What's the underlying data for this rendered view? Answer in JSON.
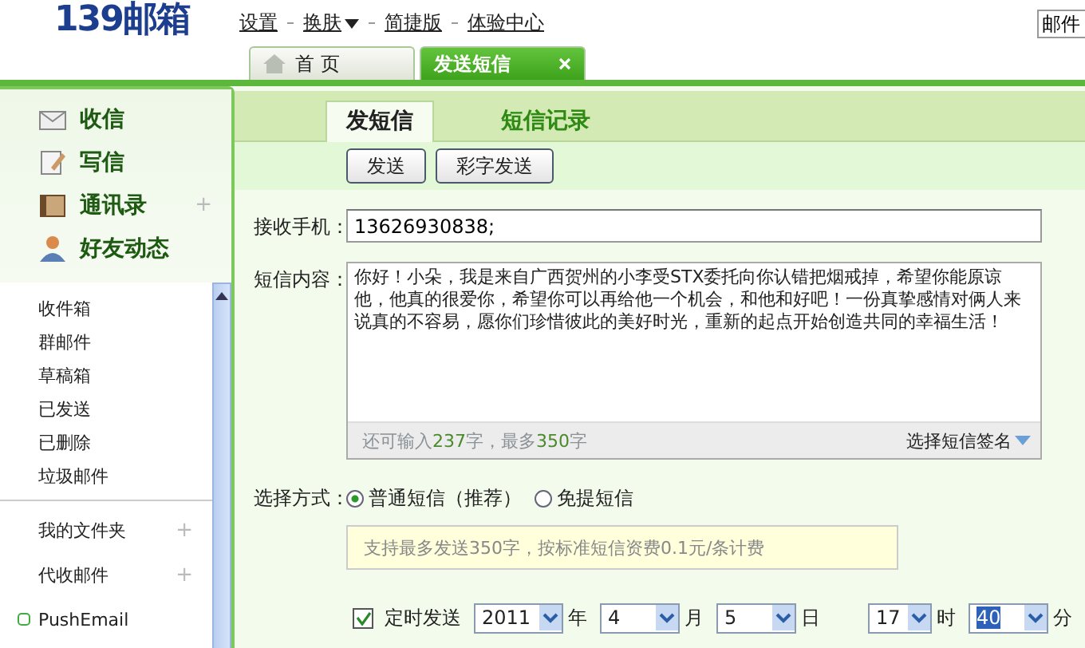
{
  "header": {
    "logo": "139邮箱",
    "links": [
      {
        "label": "设置",
        "dropdown": false
      },
      {
        "label": "换肤",
        "dropdown": true
      },
      {
        "label": "简捷版",
        "dropdown": false
      },
      {
        "label": "体验中心",
        "dropdown": false
      }
    ],
    "search_value": "邮件"
  },
  "tabs": [
    {
      "label": "首 页",
      "kind": "home",
      "selected": false
    },
    {
      "label": "发送短信",
      "kind": "closable",
      "selected": true
    }
  ],
  "sidebar": {
    "main_items": [
      {
        "label": "收信",
        "kind": "inbox"
      },
      {
        "label": "写信",
        "kind": "write"
      },
      {
        "label": "通讯录",
        "kind": "book",
        "action": "+"
      },
      {
        "label": "好友动态",
        "kind": "person"
      }
    ],
    "folders": [
      {
        "label": "收件箱"
      },
      {
        "label": "群邮件"
      },
      {
        "label": "草稿箱"
      },
      {
        "label": "已发送"
      },
      {
        "label": "已删除"
      },
      {
        "label": "垃圾邮件"
      }
    ],
    "groups": [
      {
        "label": "我的文件夹",
        "kind": "folder",
        "action": "+"
      },
      {
        "label": "代收邮件",
        "kind": "folder",
        "action": "+"
      },
      {
        "label": "PushEmail",
        "kind": "push"
      }
    ]
  },
  "subtabs": [
    {
      "label": "发短信",
      "selected": true
    },
    {
      "label": "短信记录",
      "selected": false
    }
  ],
  "toolbar": [
    "发送",
    "彩字发送"
  ],
  "form": {
    "recipient_label": "接收手机：",
    "recipient_value": "13626930838;",
    "content_label": "短信内容：",
    "content_value": "你好！小朵，我是来自广西贺州的小李受STX委托向你认错把烟戒掉，希望你能原谅他，他真的很爱你，希望你可以再给他一个机会，和他和好吧！一份真挚感情对俩人来说真的不容易，愿你们珍惜彼此的美好时光，重新的起点开始创造共同的幸福生活！",
    "counter_parts": [
      {
        "text": "还可输入",
        "kind": "plain"
      },
      {
        "text": "237",
        "kind": "num"
      },
      {
        "text": "字，最多",
        "kind": "plain"
      },
      {
        "text": "350",
        "kind": "num"
      },
      {
        "text": "字",
        "kind": "plain"
      }
    ],
    "signature": "选择短信签名",
    "mode_label": "选择方式：",
    "modes": [
      {
        "label": "普通短信（推荐）",
        "selected": true
      },
      {
        "label": "免提短信",
        "selected": false
      }
    ],
    "mode_tip": "支持最多发送350字，按标准短信资费0.1元/条计费",
    "schedule": {
      "label": "定时发送",
      "checked": true,
      "fields": [
        {
          "value": "2011",
          "unit": "年",
          "highlight": false
        },
        {
          "value": "4",
          "unit": "月",
          "highlight": false
        },
        {
          "value": "5",
          "unit": "日",
          "highlight": false
        },
        {
          "value": "17",
          "unit": "时",
          "highlight": false
        },
        {
          "value": "40",
          "unit": "分",
          "highlight": true
        }
      ]
    }
  }
}
